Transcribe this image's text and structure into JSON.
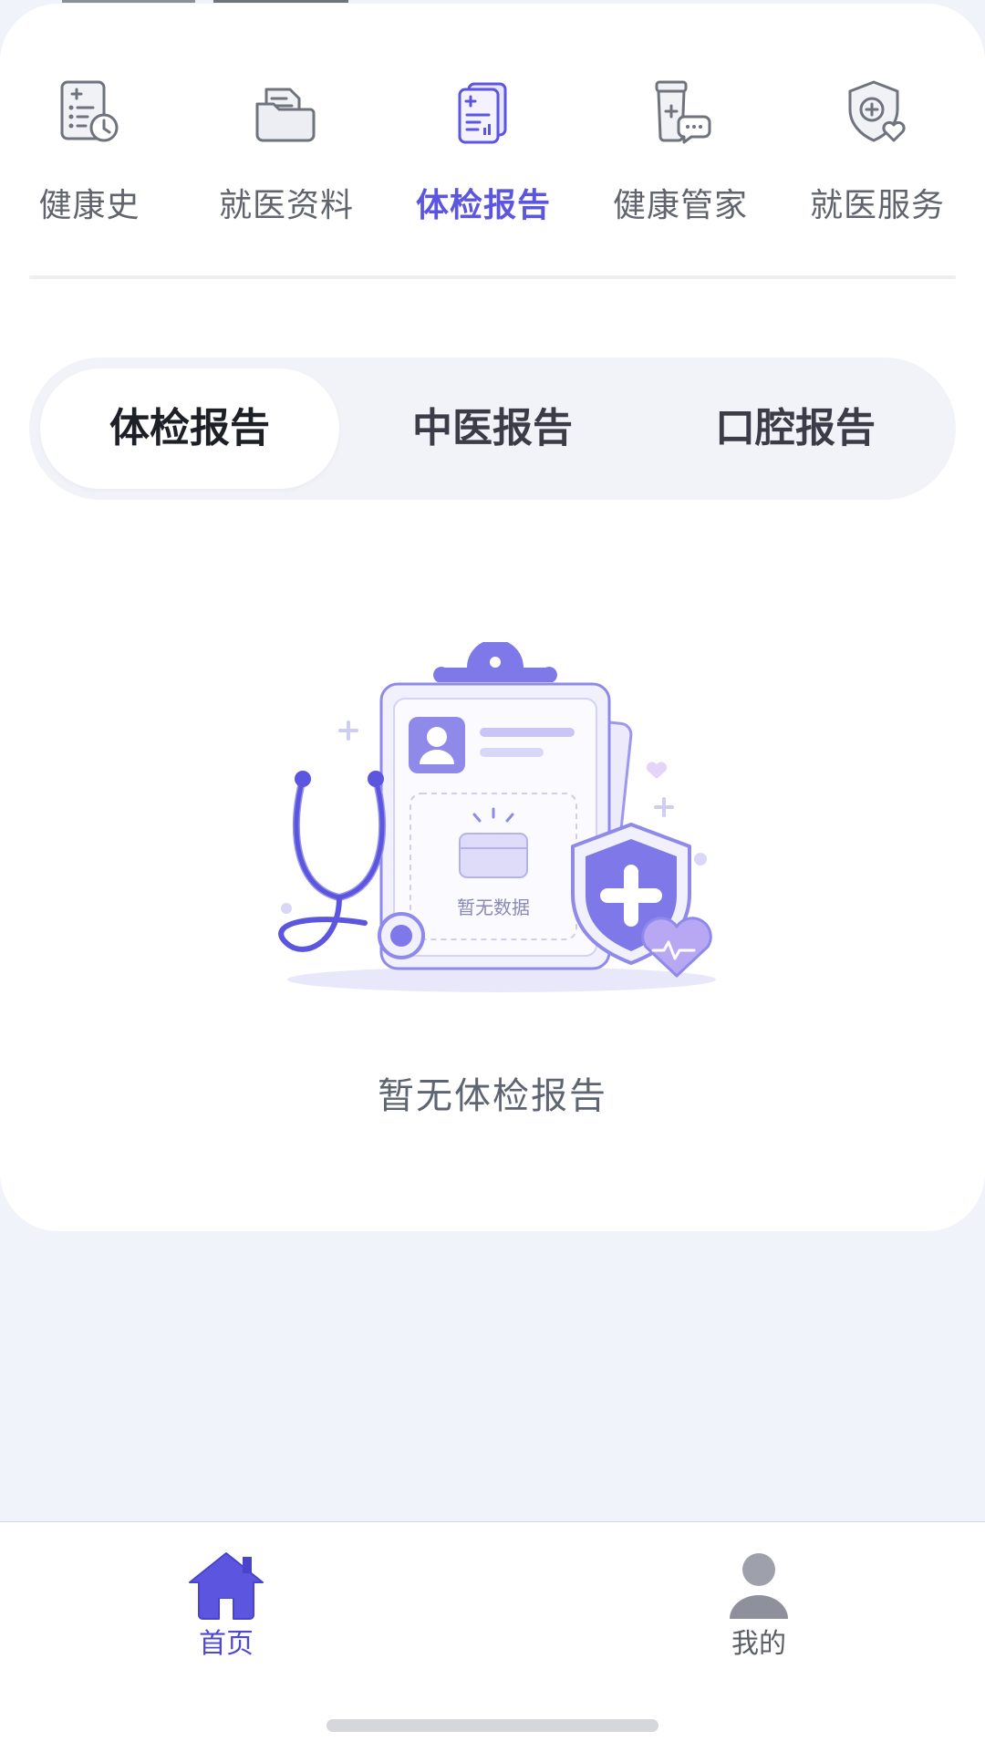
{
  "categories": [
    {
      "label": "健康史",
      "icon": "health-history-icon",
      "active": false
    },
    {
      "label": "就医资料",
      "icon": "folder-icon",
      "active": false
    },
    {
      "label": "体检报告",
      "icon": "report-icon",
      "active": true
    },
    {
      "label": "健康管家",
      "icon": "health-butler-icon",
      "active": false
    },
    {
      "label": "就医服务",
      "icon": "medical-service-icon",
      "active": false
    }
  ],
  "report_tabs": [
    {
      "label": "体检报告",
      "active": true
    },
    {
      "label": "中医报告",
      "active": false
    },
    {
      "label": "口腔报告",
      "active": false
    }
  ],
  "empty_state": {
    "illustration_text": "暂无数据",
    "message": "暂无体检报告"
  },
  "bottom_nav": [
    {
      "label": "首页",
      "icon": "home-icon",
      "active": true
    },
    {
      "label": "我的",
      "icon": "profile-icon",
      "active": false
    }
  ],
  "colors": {
    "accent": "#5b55e0",
    "background": "#f1f3fb",
    "card": "#ffffff"
  }
}
